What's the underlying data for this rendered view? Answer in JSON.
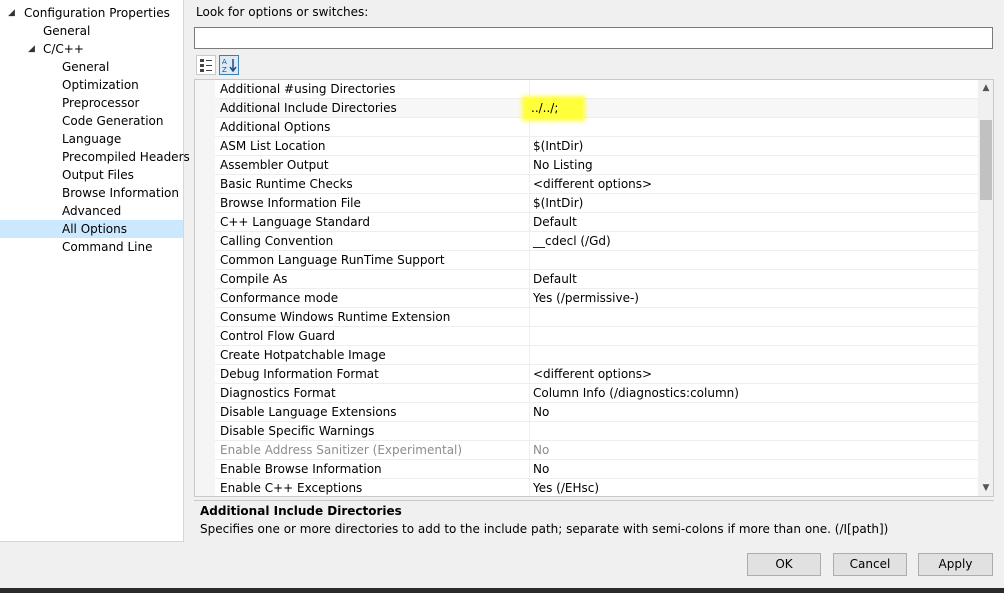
{
  "tree": {
    "root": "Configuration Properties",
    "general": "General",
    "cpp": "C/C++",
    "children": [
      "General",
      "Optimization",
      "Preprocessor",
      "Code Generation",
      "Language",
      "Precompiled Headers",
      "Output Files",
      "Browse Information",
      "Advanced",
      "All Options",
      "Command Line"
    ]
  },
  "search": {
    "label": "Look for options or switches:",
    "value": ""
  },
  "toolbar": {
    "categorized_icon": "categorized-icon",
    "alphabetical_icon": "sort-az-icon"
  },
  "properties": [
    {
      "name": "Additional #using Directories",
      "value": ""
    },
    {
      "name": "Additional Include Directories",
      "value": "../../;"
    },
    {
      "name": "Additional Options",
      "value": ""
    },
    {
      "name": "ASM List Location",
      "value": "$(IntDir)"
    },
    {
      "name": "Assembler Output",
      "value": "No Listing"
    },
    {
      "name": "Basic Runtime Checks",
      "value": "<different options>"
    },
    {
      "name": "Browse Information File",
      "value": "$(IntDir)"
    },
    {
      "name": "C++ Language Standard",
      "value": "Default"
    },
    {
      "name": "Calling Convention",
      "value": "__cdecl (/Gd)"
    },
    {
      "name": "Common Language RunTime Support",
      "value": ""
    },
    {
      "name": "Compile As",
      "value": "Default"
    },
    {
      "name": "Conformance mode",
      "value": "Yes (/permissive-)"
    },
    {
      "name": "Consume Windows Runtime Extension",
      "value": ""
    },
    {
      "name": "Control Flow Guard",
      "value": ""
    },
    {
      "name": "Create Hotpatchable Image",
      "value": ""
    },
    {
      "name": "Debug Information Format",
      "value": "<different options>"
    },
    {
      "name": "Diagnostics Format",
      "value": "Column Info (/diagnostics:column)"
    },
    {
      "name": "Disable Language Extensions",
      "value": "No"
    },
    {
      "name": "Disable Specific Warnings",
      "value": ""
    },
    {
      "name": "Enable Address Sanitizer (Experimental)",
      "value": "No"
    },
    {
      "name": "Enable Browse Information",
      "value": "No"
    },
    {
      "name": "Enable C++ Exceptions",
      "value": "Yes (/EHsc)"
    }
  ],
  "description": {
    "title": "Additional Include Directories",
    "text": "Specifies one or more directories to add to the include path; separate with semi-colons if more than one.     (/I[path])"
  },
  "buttons": {
    "ok": "OK",
    "cancel": "Cancel",
    "apply": "Apply"
  },
  "colors": {
    "highlight": "#ffff3a",
    "selection": "#cce8ff"
  }
}
